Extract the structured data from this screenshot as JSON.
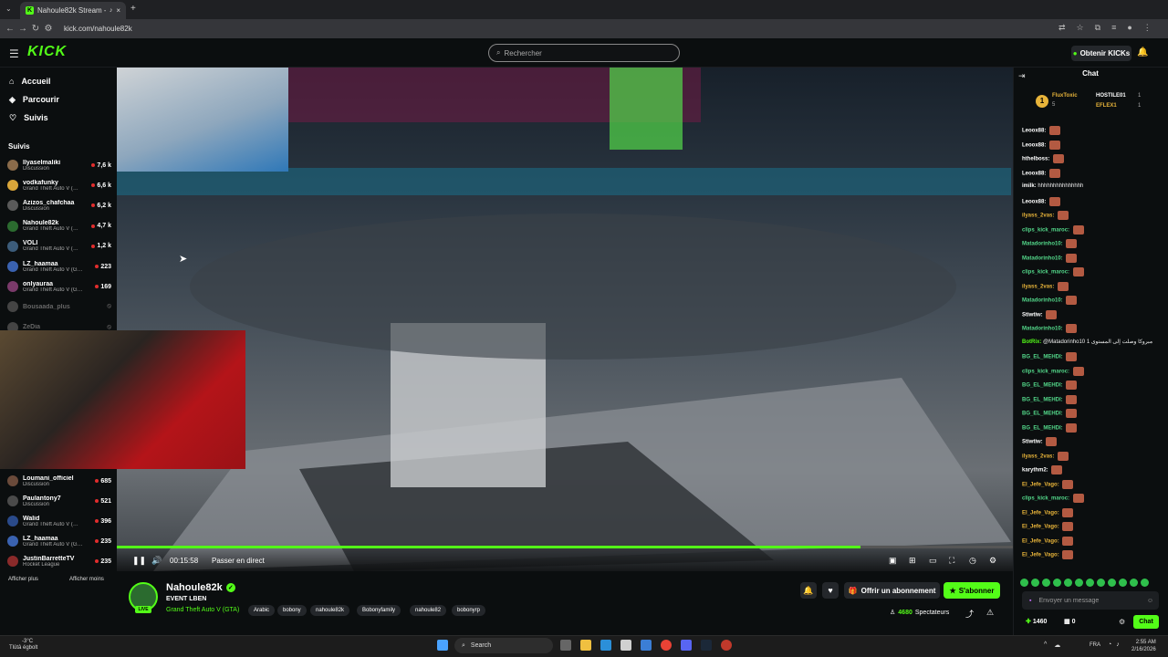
{
  "browser": {
    "tab_title": "Nahoule82k Stream - Watc",
    "url": "kick.com/nahoule82k"
  },
  "header": {
    "logo": "KICK",
    "search_placeholder": "Rechercher",
    "get_kicks": "Obtenir KICKs"
  },
  "sidebar": {
    "nav": [
      {
        "label": "Accueil",
        "icon": "home-icon"
      },
      {
        "label": "Parcourir",
        "icon": "browse-icon"
      },
      {
        "label": "Suivis",
        "icon": "heart-icon"
      }
    ],
    "following_title": "Suivis",
    "following": [
      {
        "name": "Ilyaselmaliki",
        "category": "Discussion",
        "viewers": "7,6 k",
        "color": "#8a6b4a"
      },
      {
        "name": "vodkafunky",
        "category": "Grand Theft Auto V (…",
        "viewers": "6,6 k",
        "color": "#d9a63a"
      },
      {
        "name": "Azizos_chafchaa",
        "category": "Discussion",
        "viewers": "6,2 k",
        "color": "#5a5a5a"
      },
      {
        "name": "Nahoule82k",
        "category": "Grand Theft Auto V (…",
        "viewers": "4,7 k",
        "color": "#2b6b2f"
      },
      {
        "name": "VOLI",
        "category": "Grand Theft Auto V (…",
        "viewers": "1,2 k",
        "color": "#3c5c7a"
      },
      {
        "name": "LZ_haamaa",
        "category": "Grand Theft Auto V (G…",
        "viewers": "223",
        "color": "#3a62b0"
      },
      {
        "name": "onlyauraa",
        "category": "Grand Theft Auto V (G…",
        "viewers": "169",
        "color": "#7a3a6a"
      },
      {
        "name": "Bousaada_plus",
        "category": "",
        "viewers": "",
        "color": "#444"
      },
      {
        "name": "ZeDia",
        "category": "",
        "viewers": "",
        "color": "#444"
      }
    ],
    "following_lower": [
      {
        "name": "Loumani_officiel",
        "category": "Discussion",
        "viewers": "685",
        "color": "#6a4a3a"
      },
      {
        "name": "Paulantony7",
        "category": "Discussion",
        "viewers": "521",
        "color": "#4a4a4a"
      },
      {
        "name": "Walid",
        "category": "Grand Theft Auto V (…",
        "viewers": "396",
        "color": "#2a4a8a"
      },
      {
        "name": "LZ_haamaa",
        "category": "Grand Theft Auto V (G…",
        "viewers": "235",
        "color": "#3a62b0"
      },
      {
        "name": "JustinBarretteTV",
        "category": "Rocket League",
        "viewers": "235",
        "color": "#8a2a2a"
      }
    ],
    "show_more": "Afficher plus",
    "show_less": "Afficher moins"
  },
  "player": {
    "time": "00:15:58",
    "go_live": "Passer en direct",
    "progress_fraction": 0.83
  },
  "channel": {
    "name": "Nahoule82k",
    "live_badge": "LIVE",
    "stream_title": "EVENT LBEN",
    "category": "Grand Theft Auto V (GTA)",
    "tags": [
      "Arabic",
      "bobony",
      "nahoule82k",
      "Bobonyfamily",
      "nahoule82",
      "bobonyrp"
    ],
    "gift_sub": "Offrir un abonnement",
    "subscribe": "S'abonner",
    "viewers": "4680",
    "viewers_label": "Spectateurs"
  },
  "chat": {
    "title": "Chat",
    "pinned": {
      "first": {
        "name": "FluxToxic",
        "value": "5"
      },
      "second": {
        "name": "HOSTILE01",
        "value": "1"
      },
      "third": {
        "name": "EFLEX1",
        "value": "1"
      }
    },
    "messages": [
      {
        "user": "Leoox88:",
        "text": "",
        "color": "#ffffff",
        "emote": true
      },
      {
        "user": "Leoox88:",
        "text": "",
        "color": "#ffffff",
        "emote": true
      },
      {
        "user": "hthelboss:",
        "text": "",
        "color": "#ffffff",
        "emote": true
      },
      {
        "user": "Leoox88:",
        "text": "",
        "color": "#ffffff",
        "emote": true
      },
      {
        "user": "imilk:",
        "text": "hhhhhhhhhhhhhhh",
        "color": "#ffffff",
        "emote": false
      },
      {
        "user": "Leoox88:",
        "text": "",
        "color": "#ffffff",
        "emote": true
      },
      {
        "user": "ilyass_2vas:",
        "text": "",
        "color": "#e8b43a",
        "emote": true
      },
      {
        "user": "clips_kick_maroc:",
        "text": "",
        "color": "#53d88a",
        "emote": true
      },
      {
        "user": "Matadorinho10:",
        "text": "",
        "color": "#53d88a",
        "emote": true
      },
      {
        "user": "Matadorinho10:",
        "text": "",
        "color": "#53d88a",
        "emote": true
      },
      {
        "user": "clips_kick_maroc:",
        "text": "",
        "color": "#53d88a",
        "emote": true
      },
      {
        "user": "ilyass_2vas:",
        "text": "",
        "color": "#e8b43a",
        "emote": true
      },
      {
        "user": "Matadorinho10:",
        "text": "",
        "color": "#53d88a",
        "emote": true
      },
      {
        "user": "Stiwtiw:",
        "text": "",
        "color": "#ffffff",
        "emote": true
      },
      {
        "user": "Matadorinho10:",
        "text": "",
        "color": "#53d88a",
        "emote": true
      },
      {
        "user": "BotRix:",
        "text": "@Matadorinho10 مبروكا وصلت إلى المستوى 1",
        "color": "#53fc18",
        "emote": false
      },
      {
        "user": "BG_EL_MEHDI:",
        "text": "",
        "color": "#53d88a",
        "emote": true
      },
      {
        "user": "clips_kick_maroc:",
        "text": "",
        "color": "#53d88a",
        "emote": true
      },
      {
        "user": "BG_EL_MEHDI:",
        "text": "",
        "color": "#53d88a",
        "emote": true
      },
      {
        "user": "BG_EL_MEHDI:",
        "text": "",
        "color": "#53d88a",
        "emote": true
      },
      {
        "user": "BG_EL_MEHDI:",
        "text": "",
        "color": "#53d88a",
        "emote": true
      },
      {
        "user": "BG_EL_MEHDI:",
        "text": "",
        "color": "#53d88a",
        "emote": true
      },
      {
        "user": "Stiwtiw:",
        "text": "",
        "color": "#ffffff",
        "emote": true
      },
      {
        "user": "ilyass_2vas:",
        "text": "",
        "color": "#e8b43a",
        "emote": true
      },
      {
        "user": "karythm2:",
        "text": "",
        "color": "#ffffff",
        "emote": true
      },
      {
        "user": "El_Jefe_Vago:",
        "text": "",
        "color": "#e8b43a",
        "emote": true
      },
      {
        "user": "clips_kick_maroc:",
        "text": "",
        "color": "#53d88a",
        "emote": true
      },
      {
        "user": "El_Jefe_Vago:",
        "text": "",
        "color": "#e8b43a",
        "emote": true
      },
      {
        "user": "El_Jefe_Vago:",
        "text": "",
        "color": "#e8b43a",
        "emote": true
      },
      {
        "user": "El_Jefe_Vago:",
        "text": "",
        "color": "#e8b43a",
        "emote": true
      },
      {
        "user": "El_Jefe_Vago:",
        "text": "",
        "color": "#e8b43a",
        "emote": true
      }
    ],
    "input_placeholder": "Envoyer un message",
    "kicks": "1460",
    "slots": "0",
    "chat_button": "Chat"
  },
  "taskbar": {
    "temp": "-3°C",
    "weather": "Tlûtâ égbolt",
    "search": "Search",
    "lang": "FRA",
    "time": "2:55 AM",
    "date": "2/16/2026"
  }
}
